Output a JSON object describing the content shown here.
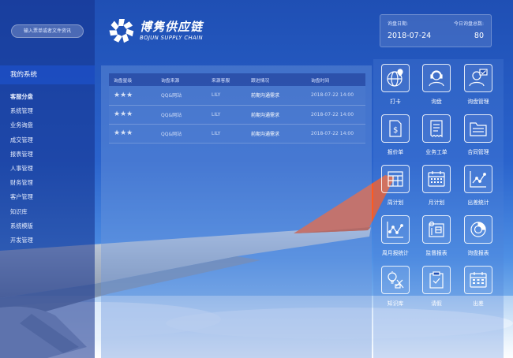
{
  "search": {
    "placeholder": "输入票单或者文件资讯"
  },
  "sidebar": {
    "title": "我的系统",
    "items": [
      {
        "label": "客服分盘"
      },
      {
        "label": "系统管理"
      },
      {
        "label": "业务询盘"
      },
      {
        "label": "成交管理"
      },
      {
        "label": "报表管理"
      },
      {
        "label": "人事管理"
      },
      {
        "label": "财务管理"
      },
      {
        "label": "客户管理"
      },
      {
        "label": "知识库"
      },
      {
        "label": "系统模版"
      },
      {
        "label": "开发管理"
      }
    ]
  },
  "logo": {
    "name_cn": "博隽供应链",
    "name_en": "BOJUN SUPPLY CHAIN"
  },
  "stats": {
    "date_label": "询盘日期:",
    "date_value": "2018-07-24",
    "count_label": "今日询盘总数:",
    "count_value": "80"
  },
  "table": {
    "headers": [
      "询盘星级",
      "询盘来源",
      "来源客服",
      "跟进情况",
      "询盘时间"
    ],
    "rows": [
      {
        "stars": "★★★",
        "source": "QQ&网站",
        "agent": "LILY",
        "status": "前期沟通需求",
        "time": "2018-07-22 14:00"
      },
      {
        "stars": "★★★",
        "source": "QQ&网站",
        "agent": "LILY",
        "status": "前期沟通需求",
        "time": "2018-07-22 14:00"
      },
      {
        "stars": "★★★",
        "source": "QQ&网站",
        "agent": "LILY",
        "status": "前期沟通需求",
        "time": "2018-07-22 14:00"
      }
    ]
  },
  "tiles": [
    {
      "label": "打卡",
      "icon": "globe-pin-icon"
    },
    {
      "label": "询盘",
      "icon": "user-support-icon"
    },
    {
      "label": "询盘管理",
      "icon": "user-check-icon"
    },
    {
      "label": "报价单",
      "icon": "dollar-document-icon"
    },
    {
      "label": "业务工单",
      "icon": "receipt-icon"
    },
    {
      "label": "合同管理",
      "icon": "folder-icon"
    },
    {
      "label": "周计划",
      "icon": "week-calendar-icon"
    },
    {
      "label": "月计划",
      "icon": "month-calendar-icon"
    },
    {
      "label": "出差统计",
      "icon": "line-chart-icon"
    },
    {
      "label": "周月报统计",
      "icon": "trend-chart-icon"
    },
    {
      "label": "监督报表",
      "icon": "blueprint-icon"
    },
    {
      "label": "询盘报表",
      "icon": "donut-chart-icon"
    },
    {
      "label": "知识库",
      "icon": "knowledge-icon"
    },
    {
      "label": "请假",
      "icon": "clipboard-icon"
    },
    {
      "label": "出差",
      "icon": "trip-calendar-icon"
    }
  ],
  "colors": {
    "accent_orange": "#ff5a1f",
    "primary_blue": "#1f4fb4"
  }
}
